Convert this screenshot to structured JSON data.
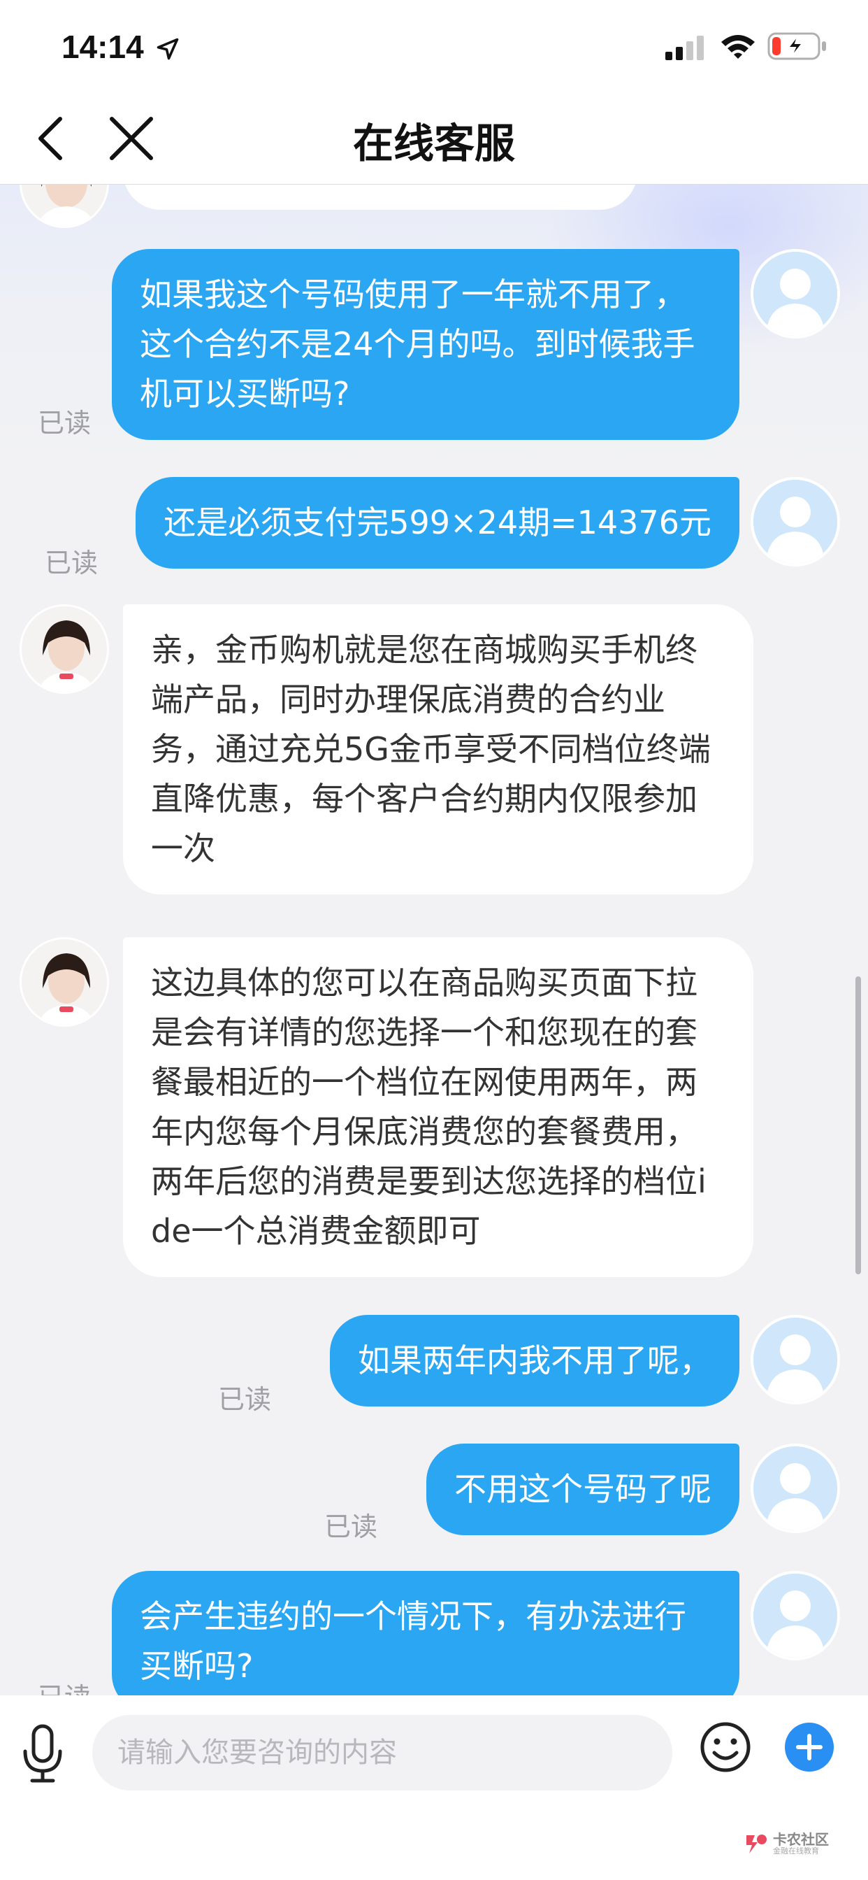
{
  "status_bar": {
    "time": "14:14",
    "icons": [
      "location-arrow-icon",
      "cellular-signal-icon",
      "wifi-icon",
      "battery-charging-icon"
    ]
  },
  "nav": {
    "title": "在线客服",
    "back_icon": "chevron-left-icon",
    "close_icon": "close-icon"
  },
  "chat": {
    "read_label": "已读",
    "messages": [
      {
        "sender": "user",
        "text": "如果我这个号码使用了一年就不用了，这个合约不是24个月的吗。到时候我手机可以买断吗?",
        "status": "已读"
      },
      {
        "sender": "user",
        "text": "还是必须支付完599×24期=14376元",
        "status": "已读"
      },
      {
        "sender": "agent",
        "text": "亲，金币购机就是您在商城购买手机终端产品，同时办理保底消费的合约业务，通过充兑5G金币享受不同档位终端直降优惠，每个客户合约期内仅限参加一次"
      },
      {
        "sender": "agent",
        "text": "这边具体的您可以在商品购买页面下拉是会有详情的您选择一个和您现在的套餐最相近的一个档位在网使用两年，两年内您每个月保底消费您的套餐费用，两年后您的消费是要到达您选择的档位ide一个总消费金额即可"
      },
      {
        "sender": "user",
        "text": "如果两年内我不用了呢，",
        "status": "已读"
      },
      {
        "sender": "user",
        "text": "不用这个号码了呢",
        "status": "已读"
      },
      {
        "sender": "user",
        "text": "会产生违约的一个情况下，有办法进行买断吗?",
        "status": "已读"
      }
    ]
  },
  "input_bar": {
    "placeholder": "请输入您要咨询的内容",
    "mic_icon": "microphone-icon",
    "emoji_icon": "smiley-icon",
    "plus_icon": "plus-circle-icon"
  },
  "watermark": {
    "name": "卡农社区",
    "subtitle": "金融在线教育"
  },
  "colors": {
    "user_bubble": "#2aa6f2",
    "agent_bubble": "#ffffff",
    "plus_button": "#2a8ff2",
    "background": "#f2f2f4"
  }
}
